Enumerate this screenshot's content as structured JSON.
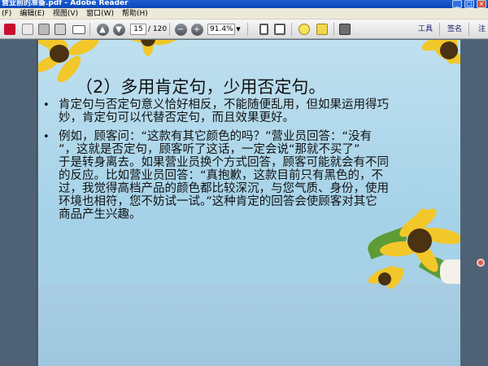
{
  "window": {
    "title": "营业前的准备.pdf - Adobe Reader",
    "controls": [
      "_",
      "□",
      "×"
    ]
  },
  "menu": {
    "items": [
      "(F)",
      "编辑(E)",
      "视图(V)",
      "窗口(W)",
      "帮助(H)"
    ]
  },
  "toolbar": {
    "page_current": "15",
    "page_total": "/ 120",
    "zoom": "91.4%",
    "tools_label": "工具",
    "sign_label": "签名",
    "comment_label": "注"
  },
  "slide": {
    "heading": "（2）多用肯定句，少用否定句。",
    "bullet_symbol": "•",
    "lines": [
      "肯定句与否定句意义恰好相反，不能随便乱用，但如果运用得巧",
      "妙，肯定句可以代替否定句，而且效果更好。",
      "例如，顾客问：“这款有其它颜色的吗？”营业员回答：“没有",
      "”，这就是否定句，顾客听了这话，一定会说“那就不买了”",
      "于是转身离去。如果营业员换个方式回答，顾客可能就会有不同",
      "的反应。比如营业员回答：“真抱歉，这款目前只有黑色的，不",
      "过，我觉得高档产品的颜色都比较深沉，与您气质、身份，使用",
      "环境也相符，您不妨试一试。”这种肯定的回答会使顾客对其它",
      "商品产生兴趣。"
    ]
  }
}
